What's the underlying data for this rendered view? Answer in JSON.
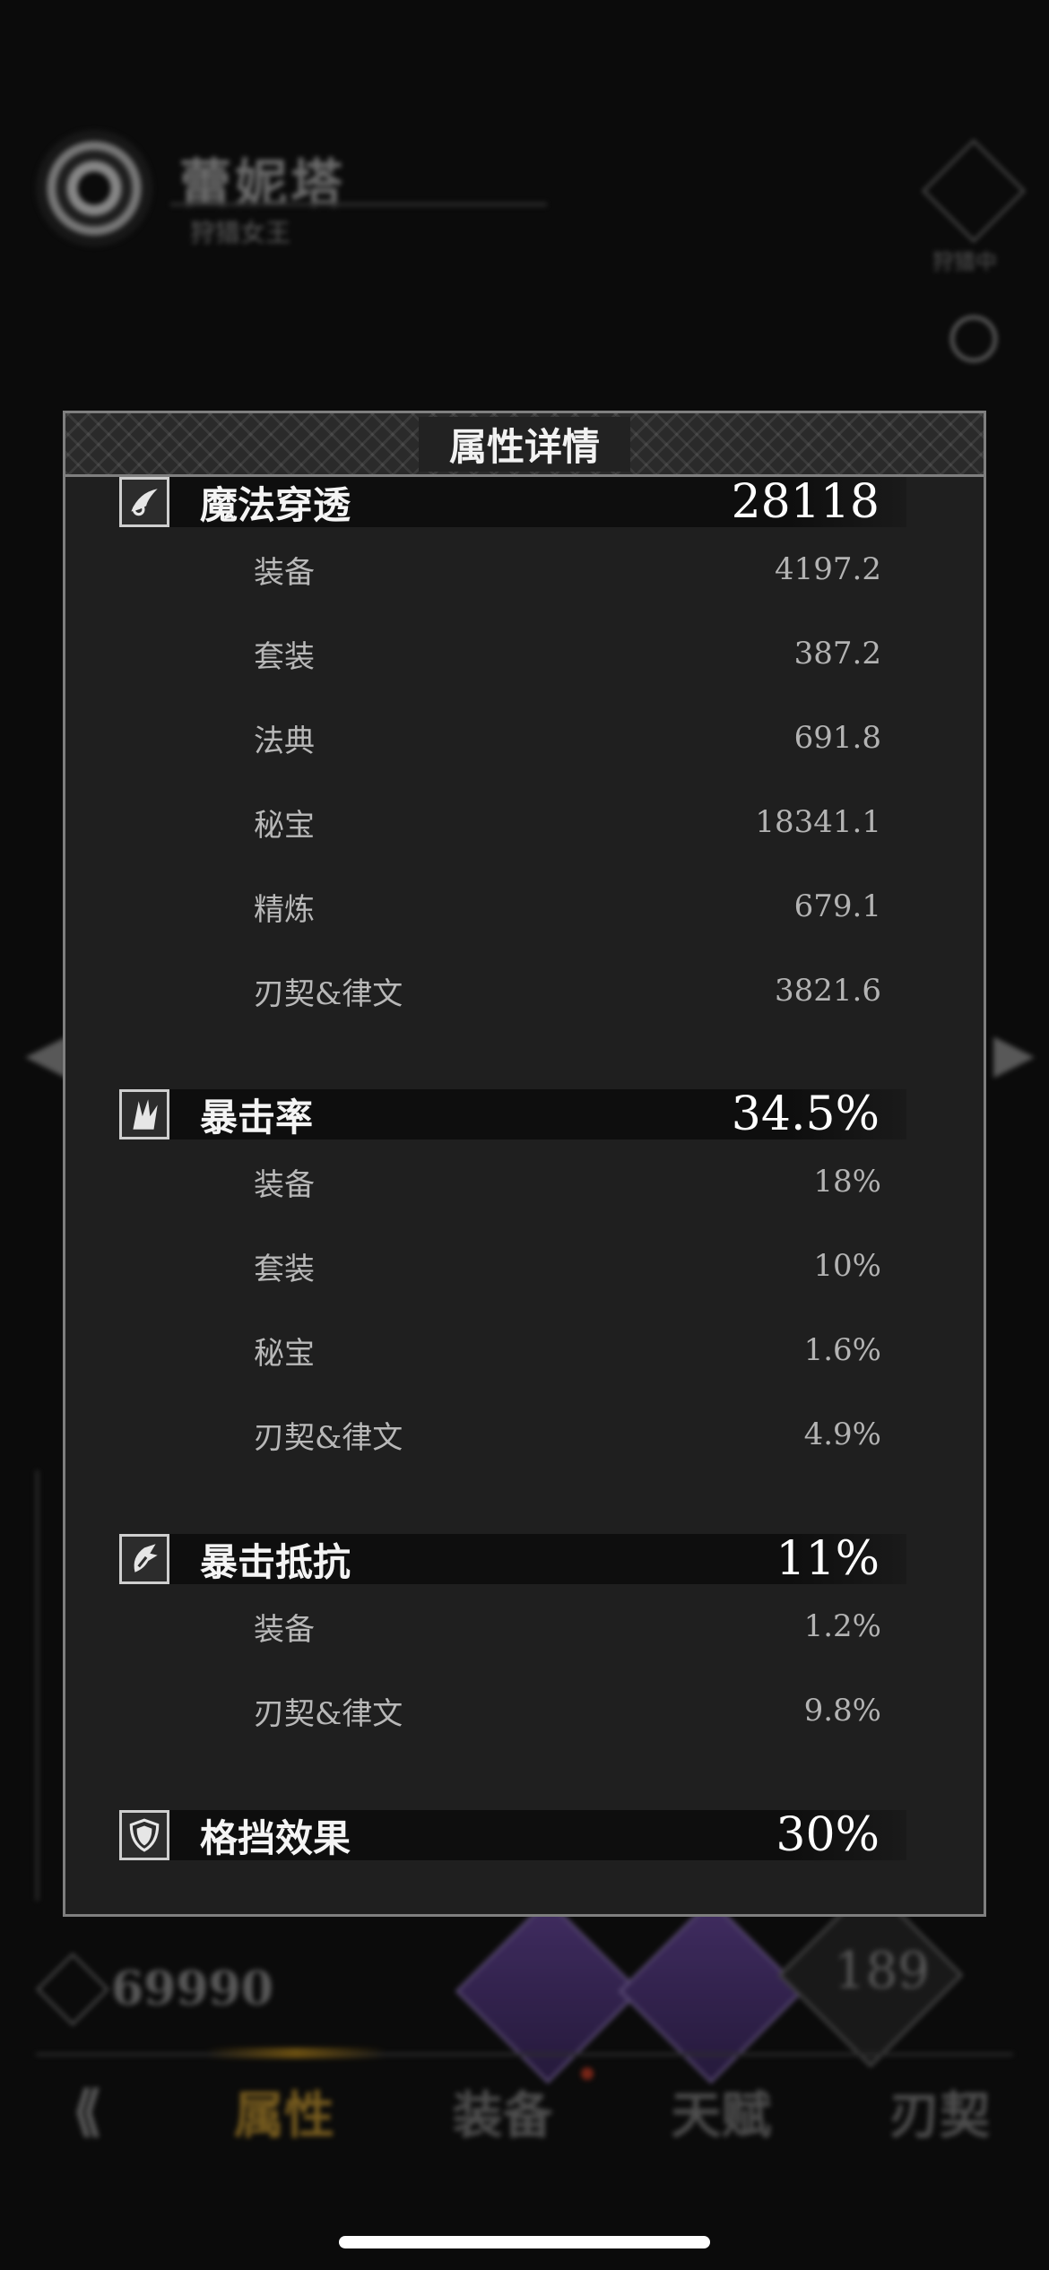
{
  "background": {
    "character_name": "蕾妮塔",
    "character_subtitle": "狩猎女王",
    "right_emblem_label": "狩猎中",
    "power_value": "69990",
    "level_value": "189",
    "tabs": [
      {
        "label": "属性",
        "active": true
      },
      {
        "label": "装备",
        "active": false,
        "has_dot": true
      },
      {
        "label": "天赋",
        "active": false
      },
      {
        "label": "刃契",
        "active": false
      }
    ]
  },
  "modal": {
    "title": "属性详情",
    "sections": [
      {
        "name": "魔法穿透",
        "value": "28118",
        "icon": "magic-penetration-icon",
        "items": [
          {
            "label": "装备",
            "value": "4197.2"
          },
          {
            "label": "套装",
            "value": "387.2"
          },
          {
            "label": "法典",
            "value": "691.8"
          },
          {
            "label": "秘宝",
            "value": "18341.1"
          },
          {
            "label": "精炼",
            "value": "679.1"
          },
          {
            "label": "刃契&律文",
            "value": "3821.6"
          }
        ]
      },
      {
        "name": "暴击率",
        "value": "34.5%",
        "icon": "crit-rate-icon",
        "items": [
          {
            "label": "装备",
            "value": "18%"
          },
          {
            "label": "套装",
            "value": "10%"
          },
          {
            "label": "秘宝",
            "value": "1.6%"
          },
          {
            "label": "刃契&律文",
            "value": "4.9%"
          }
        ]
      },
      {
        "name": "暴击抵抗",
        "value": "11%",
        "icon": "crit-resist-icon",
        "items": [
          {
            "label": "装备",
            "value": "1.2%"
          },
          {
            "label": "刃契&律文",
            "value": "9.8%"
          }
        ]
      },
      {
        "name": "格挡效果",
        "value": "30%",
        "icon": "shield-icon",
        "items": []
      }
    ]
  },
  "colors": {
    "modal_bg": "#1f1f1f",
    "modal_border": "#7f7f7f",
    "active_tab": "#8a6a22"
  }
}
